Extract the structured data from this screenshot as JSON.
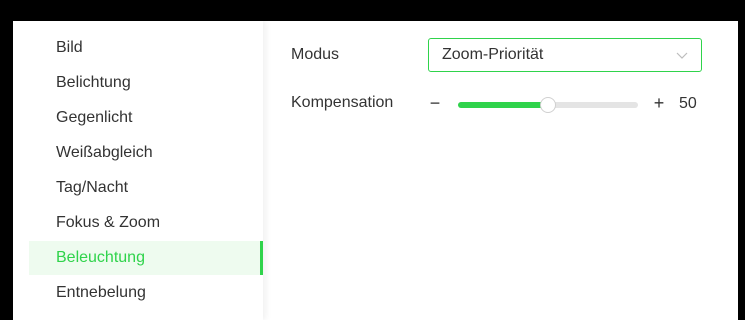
{
  "sidebar": {
    "items": [
      {
        "label": "Bild",
        "active": false
      },
      {
        "label": "Belichtung",
        "active": false
      },
      {
        "label": "Gegenlicht",
        "active": false
      },
      {
        "label": "Weißabgleich",
        "active": false
      },
      {
        "label": "Tag/Nacht",
        "active": false
      },
      {
        "label": "Fokus & Zoom",
        "active": false
      },
      {
        "label": "Beleuchtung",
        "active": true
      },
      {
        "label": "Entnebelung",
        "active": false
      }
    ]
  },
  "settings": {
    "mode": {
      "label": "Modus",
      "value": "Zoom-Priorität"
    },
    "compensation": {
      "label": "Kompensation",
      "minus": "−",
      "plus": "+",
      "value": "50",
      "level": 0.5
    }
  },
  "icons": {
    "dropdown": "chevron-down-icon"
  },
  "colors": {
    "accent": "#2fd34b",
    "active_bg": "#eefbef",
    "text": "#333333",
    "frame": "#000000"
  }
}
